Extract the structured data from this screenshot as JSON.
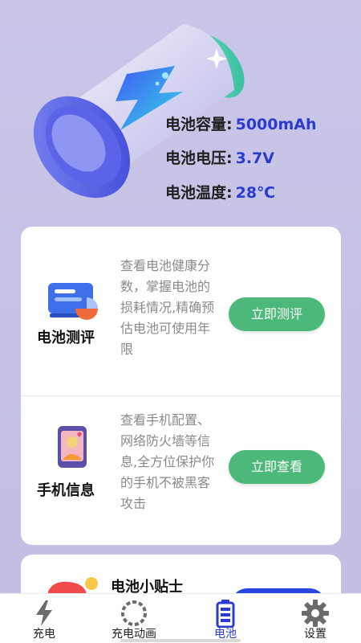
{
  "specs": [
    {
      "label": "电池容量:",
      "value": "5000mAh"
    },
    {
      "label": "电池电压:",
      "value": "3.7V"
    },
    {
      "label": "电池温度:",
      "value": "28℃"
    }
  ],
  "sections": [
    {
      "title": "电池测评",
      "description": "查看电池健康分数，掌握电池的损耗情况,精确预估电池可使用年限",
      "button": "立即测评",
      "icon": "battery-report-icon"
    },
    {
      "title": "手机信息",
      "description": "查看手机配置、网络防火墙等信息,全方位保护你的手机不被黑客攻击",
      "button": "立即查看",
      "icon": "phone-info-icon"
    }
  ],
  "tips": {
    "title": "电池小贴士",
    "icon": "tips-icon"
  },
  "tabs": [
    {
      "label": "充电",
      "icon": "lightning-icon",
      "active": false
    },
    {
      "label": "充电动画",
      "icon": "loading-ring-icon",
      "active": false
    },
    {
      "label": "电池",
      "icon": "battery-icon",
      "active": true
    },
    {
      "label": "设置",
      "icon": "gear-icon",
      "active": false
    }
  ],
  "colors": {
    "background": "#c5c2e6",
    "accent_blue": "#2a3bd0",
    "button_green": "#4cb87a",
    "tab_active": "#2a3bd0"
  }
}
